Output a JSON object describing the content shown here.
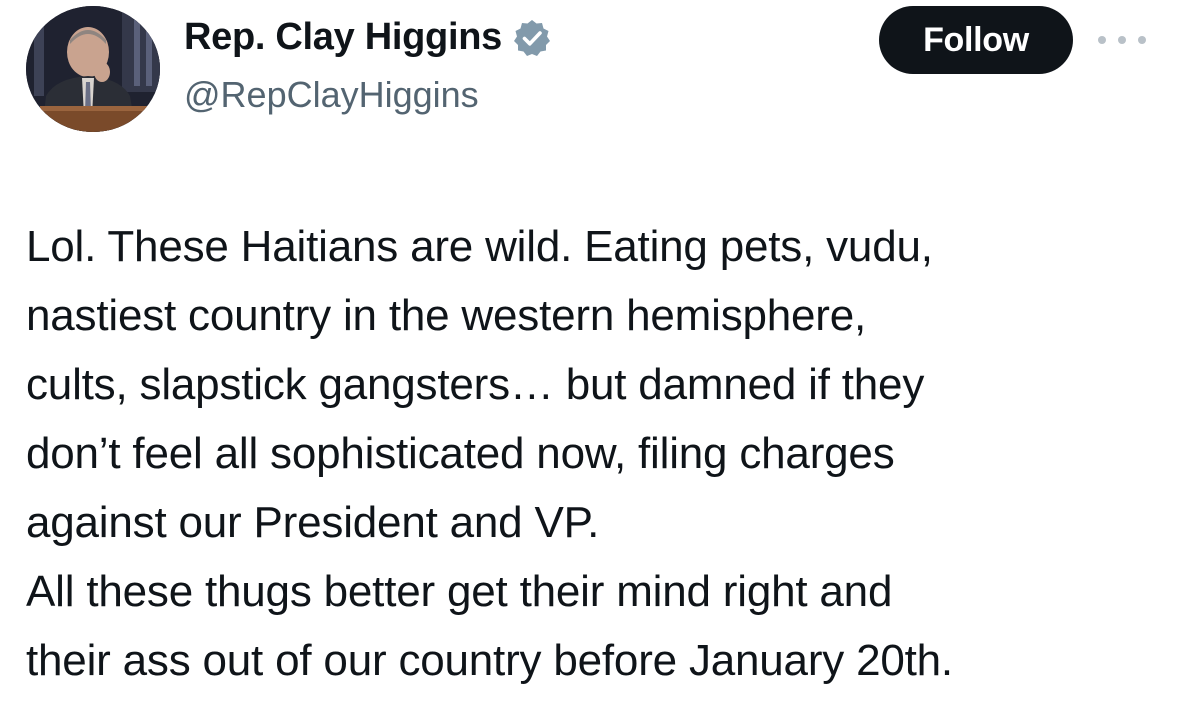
{
  "author": {
    "display_name": "Rep. Clay Higgins",
    "handle": "@RepClayHiggins",
    "verified_icon": "verified-badge-icon",
    "avatar": "avatar-photo"
  },
  "actions": {
    "follow_label": "Follow",
    "more_icon": "more-options-icon"
  },
  "tweet": {
    "text": "Lol. These Haitians are wild. Eating pets, vudu,\nnastiest country in the western hemisphere,\ncults, slapstick gangsters… but damned if they\ndon’t feel all sophisticated now, filing charges\nagainst our President and VP.\n  All these thugs better get their mind right and\ntheir ass out of our country before January 20th."
  },
  "colors": {
    "text": "#0f1419",
    "secondary": "#536471",
    "button_bg": "#0f1419",
    "verified_badge": "#829aab"
  }
}
